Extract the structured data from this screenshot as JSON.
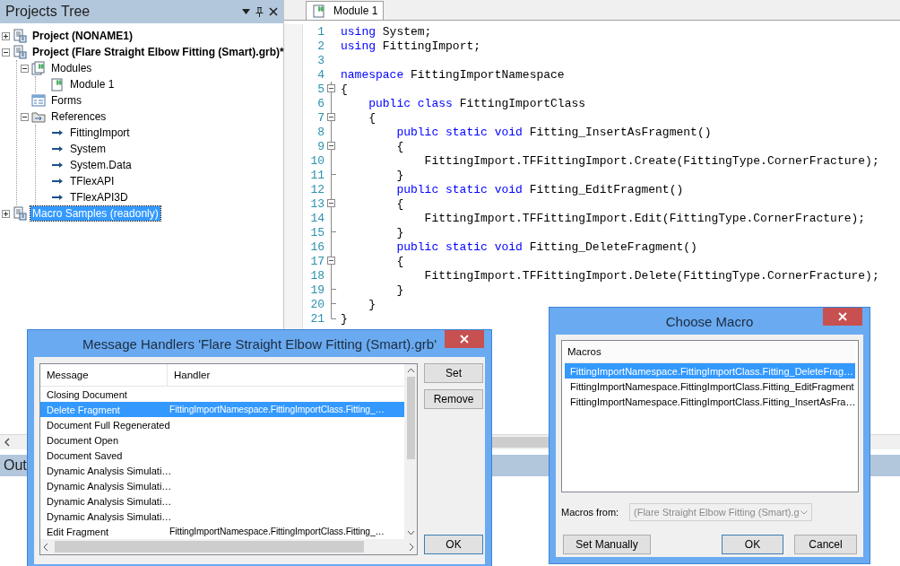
{
  "projects_tree": {
    "title": "Projects Tree",
    "items": [
      {
        "label": "Project (NONAME1)",
        "kind": "project",
        "bold": true,
        "expanded": false,
        "selected": false
      },
      {
        "label": "Project (Flare Straight Elbow Fitting (Smart).grb)*",
        "kind": "project",
        "bold": true,
        "expanded": true,
        "selected": false,
        "children": [
          {
            "label": "Modules",
            "kind": "modules",
            "bold": false,
            "expanded": true,
            "selected": false,
            "children": [
              {
                "label": "Module 1",
                "kind": "module",
                "bold": false,
                "selected": false
              }
            ]
          },
          {
            "label": "Forms",
            "kind": "forms",
            "bold": false,
            "selected": false
          },
          {
            "label": "References",
            "kind": "references",
            "bold": false,
            "expanded": true,
            "selected": false,
            "children": [
              {
                "label": "FittingImport",
                "kind": "reference",
                "bold": false,
                "selected": false
              },
              {
                "label": "System",
                "kind": "reference",
                "bold": false,
                "selected": false
              },
              {
                "label": "System.Data",
                "kind": "reference",
                "bold": false,
                "selected": false
              },
              {
                "label": "TFlexAPI",
                "kind": "reference",
                "bold": false,
                "selected": false
              },
              {
                "label": "TFlexAPI3D",
                "kind": "reference",
                "bold": false,
                "selected": false
              }
            ]
          }
        ]
      },
      {
        "label": "Macro Samples (readonly)",
        "kind": "project",
        "bold": false,
        "expanded": false,
        "selected": true
      }
    ]
  },
  "editor": {
    "tabs": [
      {
        "label": "Module 1",
        "selected": true
      }
    ],
    "lines": [
      {
        "number": "1",
        "kind": "plain",
        "tokens": [
          {
            "kind": "keyword",
            "text": "using"
          },
          {
            "kind": "plain",
            "text": " System;"
          }
        ]
      },
      {
        "number": "2",
        "kind": "plain",
        "tokens": [
          {
            "kind": "keyword",
            "text": "using"
          },
          {
            "kind": "plain",
            "text": " FittingImport;"
          }
        ]
      },
      {
        "number": "3",
        "kind": "plain"
      },
      {
        "number": "4",
        "kind": "plain",
        "tokens": [
          {
            "kind": "keyword",
            "text": "namespace"
          },
          {
            "kind": "plain",
            "text": " FittingImportNamespace"
          }
        ]
      },
      {
        "number": "5",
        "kind": "fold_start",
        "tokens": [
          {
            "kind": "plain",
            "text": "{"
          }
        ]
      },
      {
        "number": "6",
        "kind": "fold_inside",
        "tokens": [
          {
            "kind": "keyword",
            "text": "    public class"
          },
          {
            "kind": "plain",
            "text": " FittingImportClass"
          }
        ]
      },
      {
        "number": "7",
        "kind": "fold_start",
        "tokens": [
          {
            "kind": "plain",
            "text": "    {"
          }
        ]
      },
      {
        "number": "8",
        "kind": "fold_inside",
        "tokens": [
          {
            "kind": "keyword",
            "text": "        public static void"
          },
          {
            "kind": "plain",
            "text": " Fitting_InsertAsFragment()"
          }
        ]
      },
      {
        "number": "9",
        "kind": "fold_start",
        "tokens": [
          {
            "kind": "plain",
            "text": "        {"
          }
        ]
      },
      {
        "number": "10",
        "kind": "fold_inside",
        "tokens": [
          {
            "kind": "plain",
            "text": "            FittingImport.TFFittingImport.Create(FittingType.CornerFracture);"
          }
        ]
      },
      {
        "number": "11",
        "kind": "fold_end",
        "tokens": [
          {
            "kind": "plain",
            "text": "        }"
          }
        ]
      },
      {
        "number": "12",
        "kind": "fold_inside",
        "tokens": [
          {
            "kind": "keyword",
            "text": "        public static void"
          },
          {
            "kind": "plain",
            "text": " Fitting_EditFragment()"
          }
        ]
      },
      {
        "number": "13",
        "kind": "fold_start",
        "tokens": [
          {
            "kind": "plain",
            "text": "        {"
          }
        ]
      },
      {
        "number": "14",
        "kind": "fold_inside",
        "tokens": [
          {
            "kind": "plain",
            "text": "            FittingImport.TFFittingImport.Edit(FittingType.CornerFracture);"
          }
        ]
      },
      {
        "number": "15",
        "kind": "fold_end",
        "tokens": [
          {
            "kind": "plain",
            "text": "        }"
          }
        ]
      },
      {
        "number": "16",
        "kind": "fold_inside",
        "tokens": [
          {
            "kind": "keyword",
            "text": "        public static void"
          },
          {
            "kind": "plain",
            "text": " Fitting_DeleteFragment()"
          }
        ]
      },
      {
        "number": "17",
        "kind": "fold_start",
        "tokens": [
          {
            "kind": "plain",
            "text": "        {"
          }
        ]
      },
      {
        "number": "18",
        "kind": "fold_inside",
        "tokens": [
          {
            "kind": "plain",
            "text": "            FittingImport.TFFittingImport.Delete(FittingType.CornerFracture);"
          }
        ]
      },
      {
        "number": "19",
        "kind": "fold_end",
        "tokens": [
          {
            "kind": "plain",
            "text": "        }"
          }
        ]
      },
      {
        "number": "20",
        "kind": "fold_end",
        "tokens": [
          {
            "kind": "plain",
            "text": "    }"
          }
        ]
      },
      {
        "number": "21",
        "kind": "fold_last",
        "tokens": [
          {
            "kind": "plain",
            "text": "}"
          }
        ]
      }
    ]
  },
  "output_panel": {
    "title": "Out"
  },
  "message_handlers_dialog": {
    "title": "Message Handlers 'Flare Straight Elbow Fitting (Smart).grb'",
    "columns": [
      "Message",
      "Handler"
    ],
    "rows": [
      {
        "message": "Closing Document",
        "selected": false
      },
      {
        "message": "Delete Fragment",
        "handler": "FittingImportNamespace.FittingImportClass.Fitting_…",
        "selected": true
      },
      {
        "message": "Document Full Regenerated",
        "selected": false
      },
      {
        "message": "Document Open",
        "selected": false
      },
      {
        "message": "Document Saved",
        "selected": false
      },
      {
        "message": "Dynamic Analysis Simulati…",
        "selected": false
      },
      {
        "message": "Dynamic Analysis Simulati…",
        "selected": false
      },
      {
        "message": "Dynamic Analysis Simulati…",
        "selected": false
      },
      {
        "message": "Dynamic Analysis Simulati…",
        "selected": false
      },
      {
        "message": "Edit Fragment",
        "handler": "FittingImportNamespace.FittingImportClass.Fitting_…",
        "selected": false
      }
    ],
    "side_buttons": [
      "Set",
      "Remove"
    ],
    "ok_button": "OK"
  },
  "choose_macro_dialog": {
    "title": "Choose Macro",
    "list_header": "Macros",
    "macros": [
      {
        "label": "FittingImportNamespace.FittingImportClass.Fitting_DeleteFrag…",
        "selected": true
      },
      {
        "label": "FittingImportNamespace.FittingImportClass.Fitting_EditFragment",
        "selected": false
      },
      {
        "label": "FittingImportNamespace.FittingImportClass.Fitting_InsertAsFra…",
        "selected": false
      }
    ],
    "source_label": "Macros from:",
    "source_value": "(Flare Straight Elbow Fitting (Smart).g",
    "source_disabled": true,
    "buttons": [
      "Set Manually",
      "OK",
      "Cancel"
    ]
  }
}
